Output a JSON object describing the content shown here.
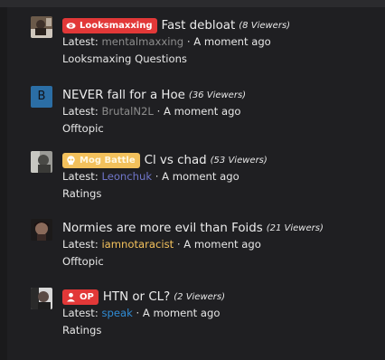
{
  "colors": {
    "badge_red": "#e23838",
    "badge_gold": "#f3c15c",
    "link_blue": "#2f8bd4",
    "link_purple": "#6f75c8",
    "link_gold": "#f3c15c",
    "link_grey": "#8d8d8d"
  },
  "threads": [
    {
      "badge": {
        "label": "Looksmaxxing",
        "icon": "eye-icon"
      },
      "title": "Fast debloat",
      "viewers": "(8 Viewers)",
      "latest_prefix": "Latest:",
      "latest_user": "mentalmaxxing",
      "separator": "·",
      "time": "A moment ago",
      "forum": "Looksmaxing Questions"
    },
    {
      "avatar_letter": "B",
      "title": "NEVER fall for a Hoe",
      "viewers": "(36 Viewers)",
      "latest_prefix": "Latest:",
      "latest_user": "BrutalN2L",
      "separator": "·",
      "time": "A moment ago",
      "forum": "Offtopic"
    },
    {
      "badge": {
        "label": "Mog Battle",
        "icon": "skull-icon"
      },
      "title": "Cl vs chad",
      "viewers": "(53 Viewers)",
      "latest_prefix": "Latest:",
      "latest_user": "Leonchuk",
      "separator": "·",
      "time": "A moment ago",
      "forum": "Ratings"
    },
    {
      "title": "Normies are more evil than Foids",
      "viewers": "(21 Viewers)",
      "latest_prefix": "Latest:",
      "latest_user": "iamnotaracist",
      "separator": "·",
      "time": "A moment ago",
      "forum": "Offtopic"
    },
    {
      "badge": {
        "label": "OP",
        "icon": "user-icon"
      },
      "title": "HTN or CL?",
      "viewers": "(2 Viewers)",
      "latest_prefix": "Latest:",
      "latest_user": "speak",
      "separator": "·",
      "time": "A moment ago",
      "forum": "Ratings"
    }
  ]
}
